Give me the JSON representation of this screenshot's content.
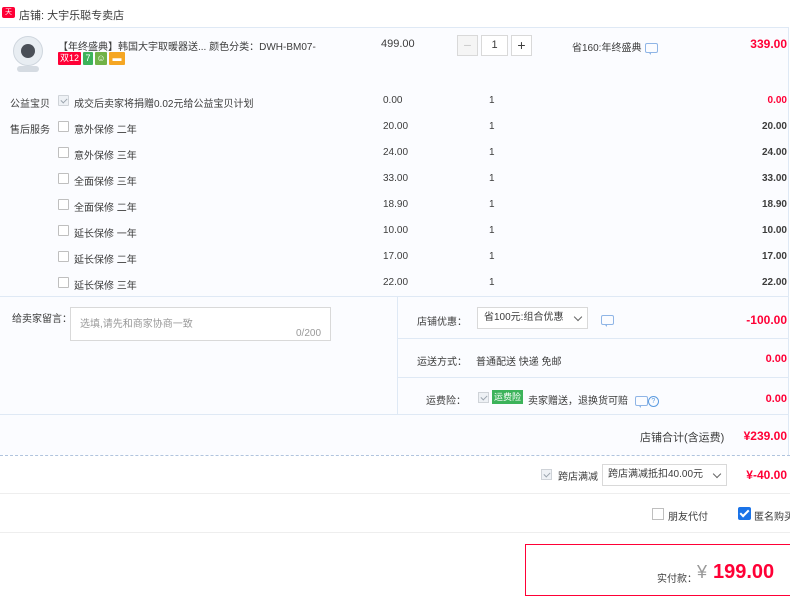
{
  "shop": {
    "logo_text": "天猫",
    "name": "店铺: 大宇乐聪专卖店"
  },
  "product": {
    "title": "【年终盛典】韩国大宇取暖器送...  颜色分类：DWH-BM07-",
    "badges": [
      "双12",
      "7",
      "",
      ""
    ],
    "price": "499.00",
    "quantity": "1",
    "promo": "省160:年终盛典",
    "total": "339.00"
  },
  "services": {
    "charity_label": "公益宝贝",
    "charity_text": "成交后卖家将捐赠0.02元给公益宝贝计划",
    "charity_price": "0.00",
    "charity_qty": "1",
    "charity_total": "0.00",
    "aftersale_label": "售后服务",
    "items": [
      {
        "name": "意外保修 二年",
        "price": "20.00",
        "qty": "1",
        "total": "20.00"
      },
      {
        "name": "意外保修 三年",
        "price": "24.00",
        "qty": "1",
        "total": "24.00"
      },
      {
        "name": "全面保修 三年",
        "price": "33.00",
        "qty": "1",
        "total": "33.00"
      },
      {
        "name": "全面保修 二年",
        "price": "18.90",
        "qty": "1",
        "total": "18.90"
      },
      {
        "name": "延长保修 一年",
        "price": "10.00",
        "qty": "1",
        "total": "10.00"
      },
      {
        "name": "延长保修 二年",
        "price": "17.00",
        "qty": "1",
        "total": "17.00"
      },
      {
        "name": "延长保修 三年",
        "price": "22.00",
        "qty": "1",
        "total": "22.00"
      }
    ]
  },
  "message": {
    "label": "给卖家留言：",
    "placeholder": "选填,请先和商家协商一致",
    "counter": "0/200"
  },
  "shop_discount": {
    "label": "店铺优惠：",
    "selected": "省100元:组合优惠",
    "value": "-100.00"
  },
  "shipping": {
    "label": "运送方式：",
    "method": "普通配送 快递 免邮",
    "value": "0.00"
  },
  "insurance": {
    "label": "运费险：",
    "badge": "运费险",
    "text": "卖家赠送，退换货可赔",
    "value": "0.00"
  },
  "shop_total": {
    "label": "店铺合计(含运费)",
    "value": "¥239.00"
  },
  "cross_store": {
    "label": "跨店满减",
    "selected": "跨店满减抵扣40.00元",
    "value": "¥-40.00"
  },
  "options": {
    "friend_pay": "朋友代付",
    "anonymous": "匿名购买"
  },
  "payment": {
    "label": "实付款：",
    "currency": "¥",
    "amount": "199.00"
  },
  "colors": {
    "accent_red": "#ff0036",
    "panel_bg": "#fbfcff",
    "link_blue": "#1a73e8"
  }
}
